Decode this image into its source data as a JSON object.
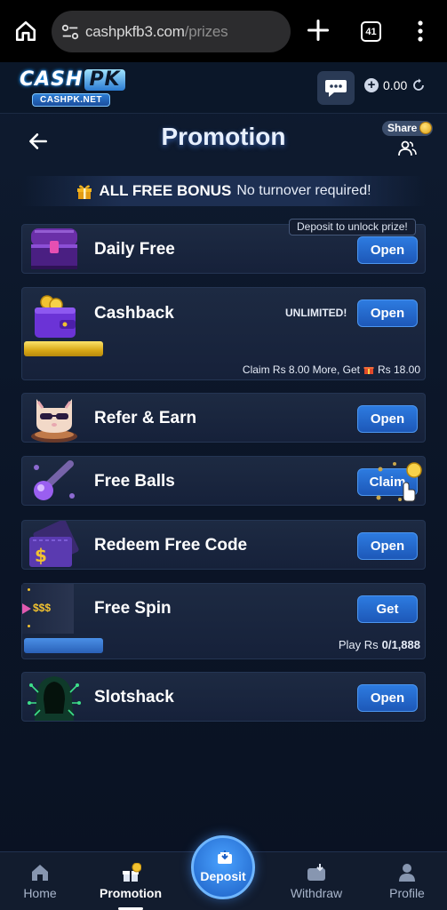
{
  "browser": {
    "url_host": "cashpkfb3.com",
    "url_path": "/prizes",
    "tab_count": "41"
  },
  "header": {
    "logo_top": "CASH",
    "logo_pk": "PK",
    "logo_sub": "CASHPK.NET",
    "balance": "0.00"
  },
  "page": {
    "title": "Promotion",
    "share_label": "Share"
  },
  "banner": {
    "bold": "ALL FREE BONUS",
    "sub": "No turnover required!"
  },
  "promotions": [
    {
      "title": "Daily Free",
      "button": "Open",
      "tag": "Deposit to unlock prize!"
    },
    {
      "title": "Cashback",
      "button": "Open",
      "badge": "UNLIMITED!",
      "progress": 0.2,
      "claim_prefix": "Claim Rs 8.00 More, Get",
      "claim_amount": "Rs 18.00"
    },
    {
      "title": "Refer & Earn",
      "button": "Open"
    },
    {
      "title": "Free Balls",
      "button": "Claim"
    },
    {
      "title": "Redeem Free Code",
      "button": "Open"
    },
    {
      "title": "Free Spin",
      "button": "Get",
      "icon_text": "$$$",
      "progress": 0.2,
      "play_prefix": "Play Rs",
      "play_value": "0/1,888"
    },
    {
      "title": "Slotshack",
      "button": "Open"
    }
  ],
  "nav": {
    "home": "Home",
    "promotion": "Promotion",
    "deposit": "Deposit",
    "withdraw": "Withdraw",
    "profile": "Profile"
  },
  "colors": {
    "accent_blue": "#2d7be0",
    "gold": "#e0a419",
    "background": "#0c1526"
  }
}
